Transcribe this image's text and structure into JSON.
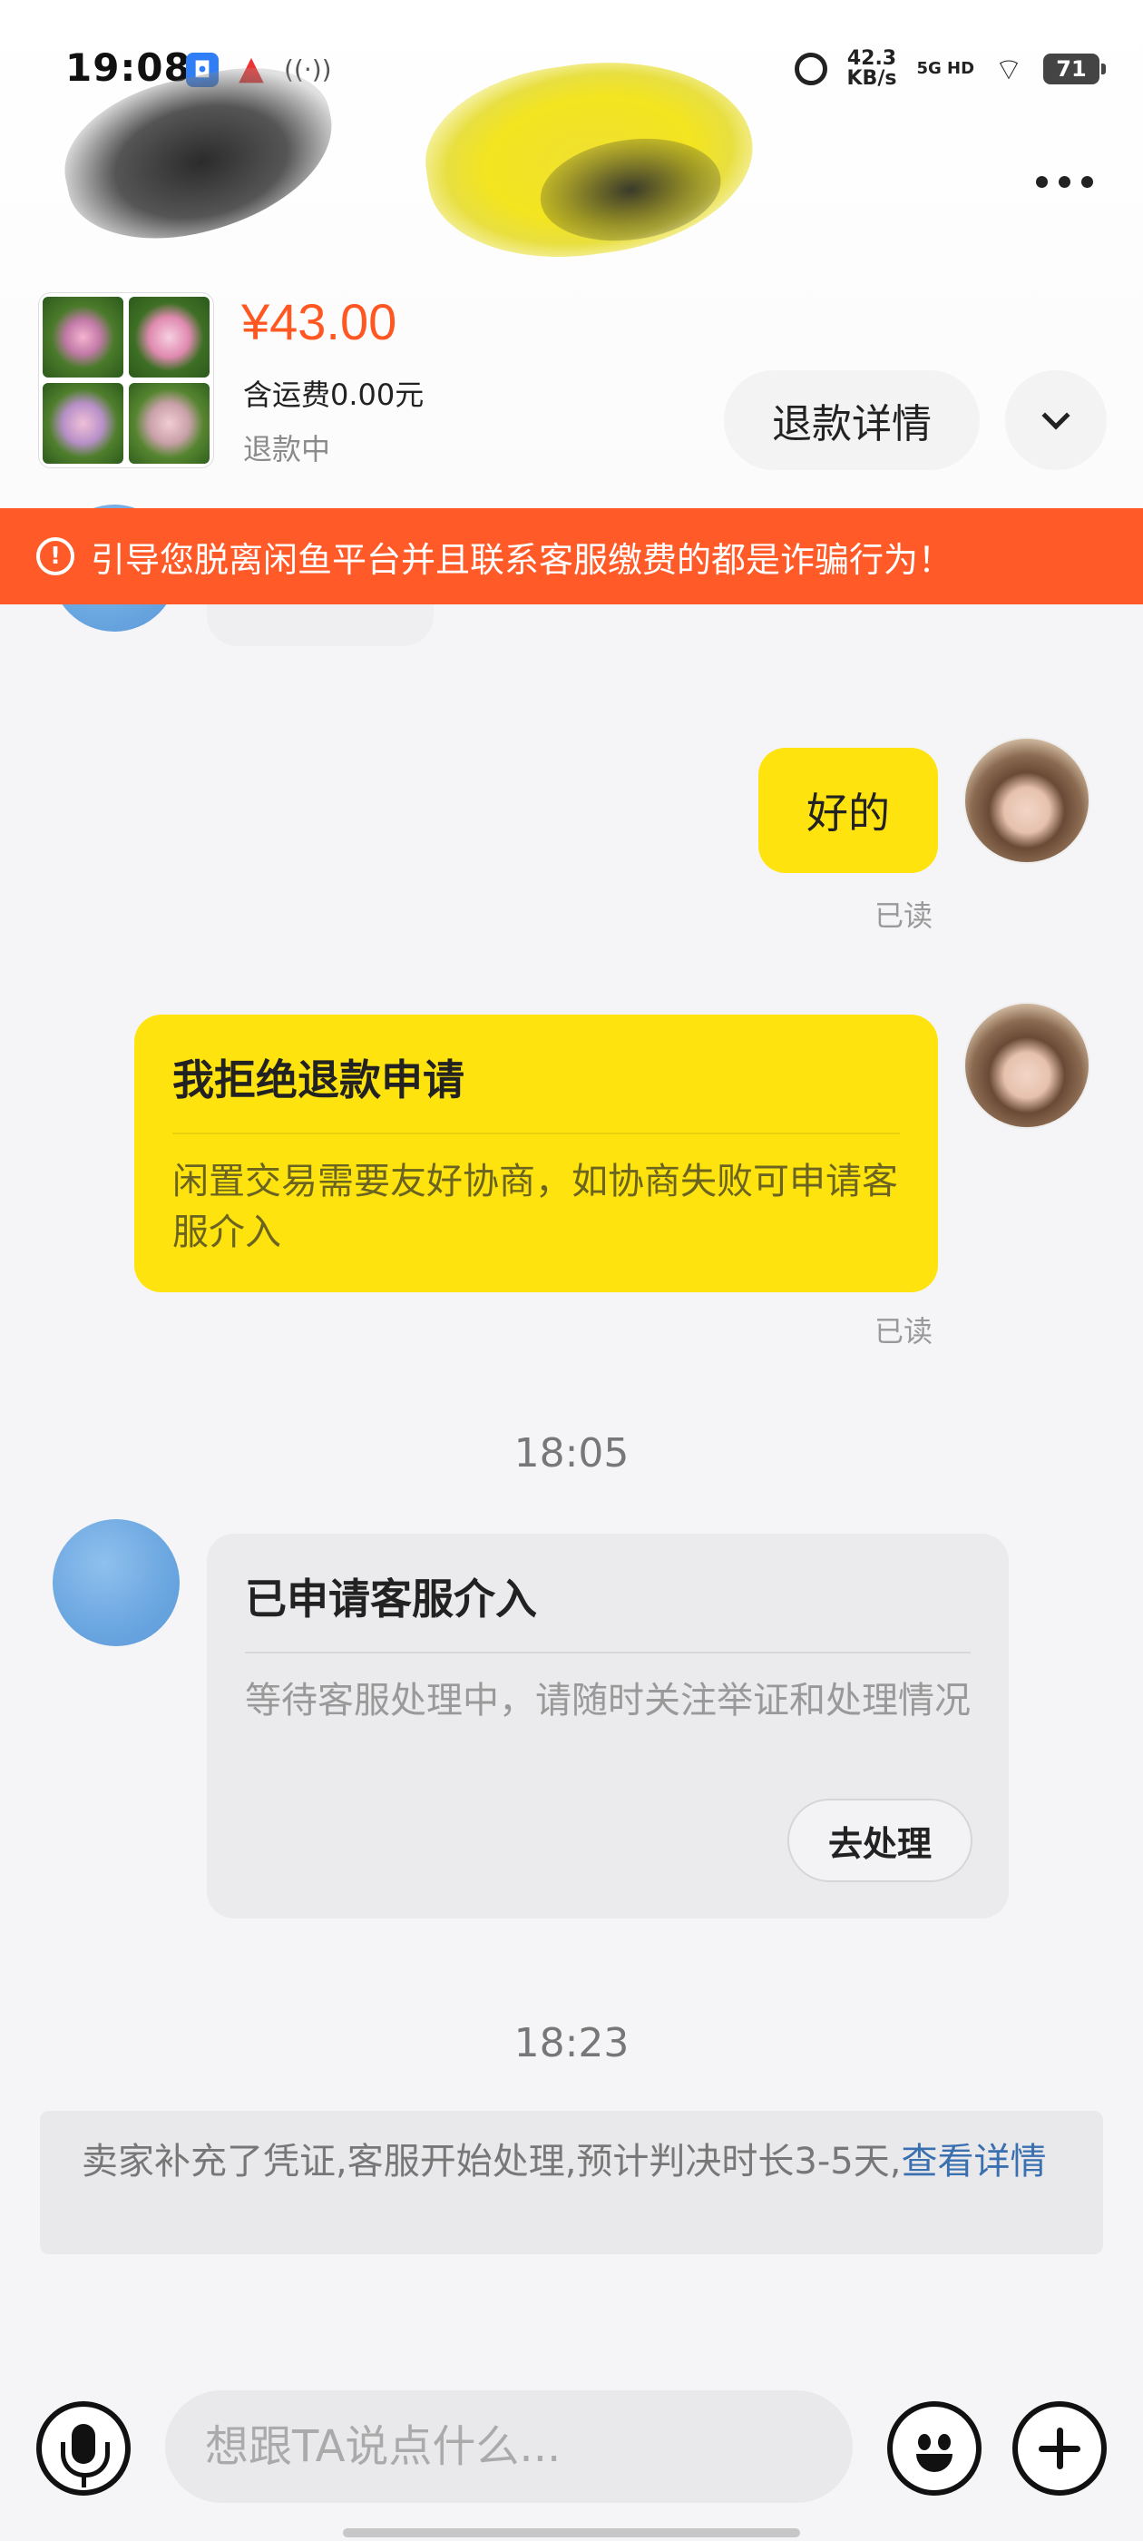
{
  "status_bar": {
    "time": "19:08",
    "speed_value": "42.3",
    "speed_unit": "KB/s",
    "network": "5G HD",
    "battery": "71"
  },
  "product": {
    "price": "¥43.00",
    "shipping": "含运费0.00元",
    "status": "退款中",
    "refund_detail_button": "退款详情"
  },
  "warning": {
    "text": "引导您脱离闲鱼平台并且联系客服缴费的都是诈骗行为！"
  },
  "messages": {
    "msg1_text": "好的",
    "msg1_read": "已读",
    "msg2_title": "我拒绝退款申请",
    "msg2_body": "闲置交易需要友好协商，如协商失败可申请客服介入",
    "msg2_read": "已读",
    "time1": "18:05",
    "msg3_title": "已申请客服介入",
    "msg3_body": "等待客服处理中，请随时关注举证和处理情况",
    "msg3_button": "去处理",
    "time2": "18:23",
    "notice_text": "卖家补充了凭证,客服开始处理,预计判决时长3-5天,",
    "notice_link": "查看详情"
  },
  "input": {
    "placeholder": "想跟TA说点什么..."
  },
  "icons": [
    "more-icon",
    "chevron-down-icon",
    "warning-icon",
    "microphone-icon",
    "emoji-icon",
    "plus-icon"
  ],
  "colors": {
    "accent_orange": "#ff5a27",
    "price_orange": "#ff5722",
    "bubble_yellow": "#ffe30f",
    "link_blue": "#3a6fb0"
  }
}
